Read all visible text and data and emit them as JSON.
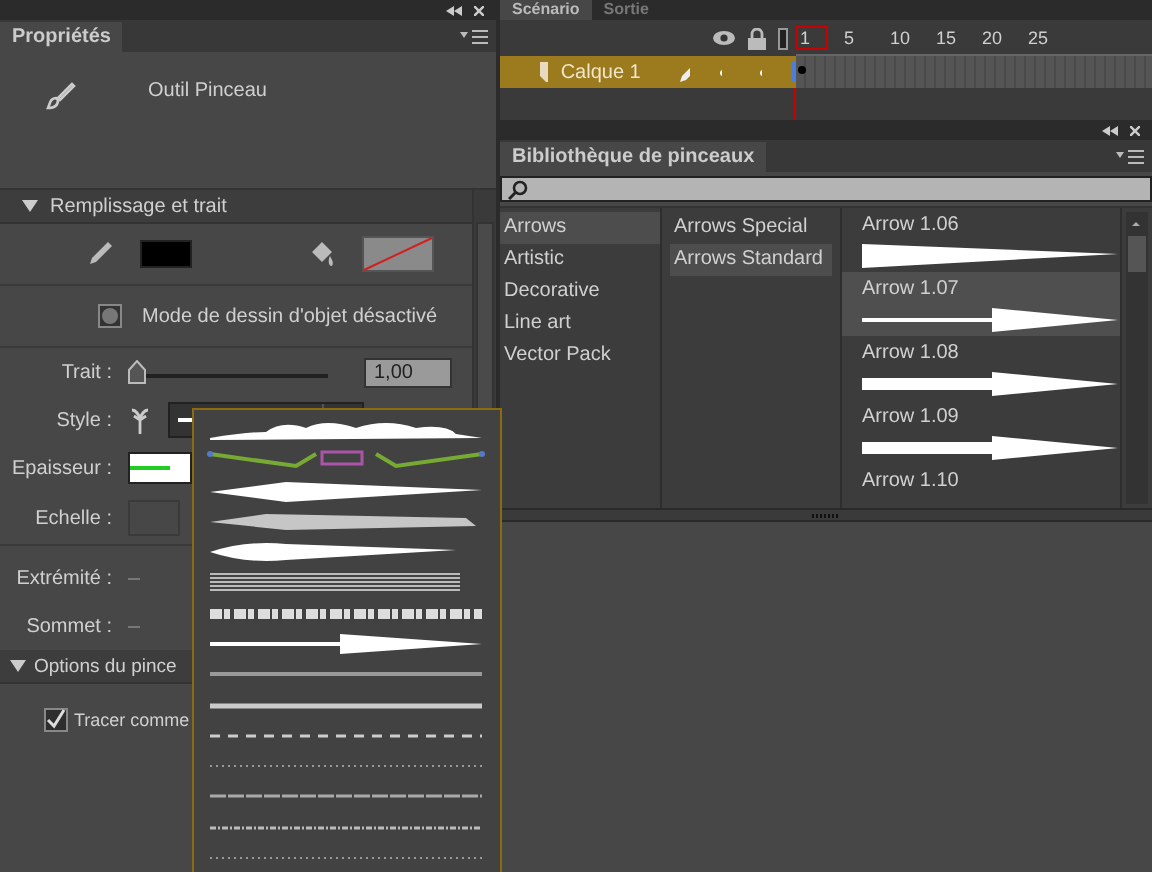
{
  "properties_panel": {
    "tabs": [
      {
        "label": "Propriétés",
        "selected": true
      }
    ],
    "tool_name": "Outil Pinceau",
    "fill_stroke": {
      "title": "Remplissage et trait",
      "expanded": true,
      "object_mode_label": "Mode de dessin d'objet désactivé",
      "stroke": {
        "label": "Trait :",
        "level": 0.0,
        "value": "1,00"
      },
      "style_label": "Style :",
      "thickness_label": "Epaisseur :",
      "scale_label": "Echelle :",
      "cap_label": "Extrémité :",
      "join_label": "Sommet :"
    },
    "brush_options": {
      "title": "Options du pince",
      "expanded": true,
      "trace_label": "Tracer comme",
      "trace_checked": true
    }
  },
  "style_dropdown": [
    {
      "kind": "cloud"
    },
    {
      "kind": "decor"
    },
    {
      "kind": "taper"
    },
    {
      "kind": "rough"
    },
    {
      "kind": "blob"
    },
    {
      "kind": "hatch"
    },
    {
      "kind": "splatter"
    },
    {
      "kind": "arrow"
    },
    {
      "kind": "solid"
    },
    {
      "kind": "thick"
    },
    {
      "kind": "dashed"
    },
    {
      "kind": "dotted"
    },
    {
      "kind": "dashdot"
    },
    {
      "kind": "ragged"
    },
    {
      "kind": "dotted"
    }
  ],
  "timeline": {
    "tabs": [
      {
        "label": "Scénario",
        "selected": true
      },
      {
        "label": "Sortie",
        "selected": false
      }
    ],
    "frames": [
      "1",
      "5",
      "10",
      "15",
      "20",
      "25"
    ],
    "layers": [
      {
        "name": "Calque 1",
        "selected": true,
        "color": "#4a7fe0"
      }
    ]
  },
  "brush_library": {
    "tabs": [
      {
        "label": "Bibliothèque de pinceaux",
        "selected": true
      }
    ],
    "categories": [
      {
        "label": "Arrows",
        "selected": true
      },
      {
        "label": "Artistic",
        "selected": false
      },
      {
        "label": "Decorative",
        "selected": false
      },
      {
        "label": "Line art",
        "selected": false
      },
      {
        "label": "Vector Pack",
        "selected": false
      }
    ],
    "subcategories": [
      {
        "label": "Arrows Special",
        "selected": false
      },
      {
        "label": "Arrows Standard",
        "selected": true
      }
    ],
    "brushes": [
      {
        "name": "Arrow 1.06",
        "kind": "wedge",
        "selected": false
      },
      {
        "name": "Arrow 1.07",
        "kind": "line-head",
        "selected": true
      },
      {
        "name": "Arrow 1.08",
        "kind": "bar-head",
        "selected": false
      },
      {
        "name": "Arrow 1.09",
        "kind": "bar-head",
        "selected": false
      },
      {
        "name": "Arrow 1.10",
        "kind": "none",
        "selected": false
      }
    ]
  }
}
